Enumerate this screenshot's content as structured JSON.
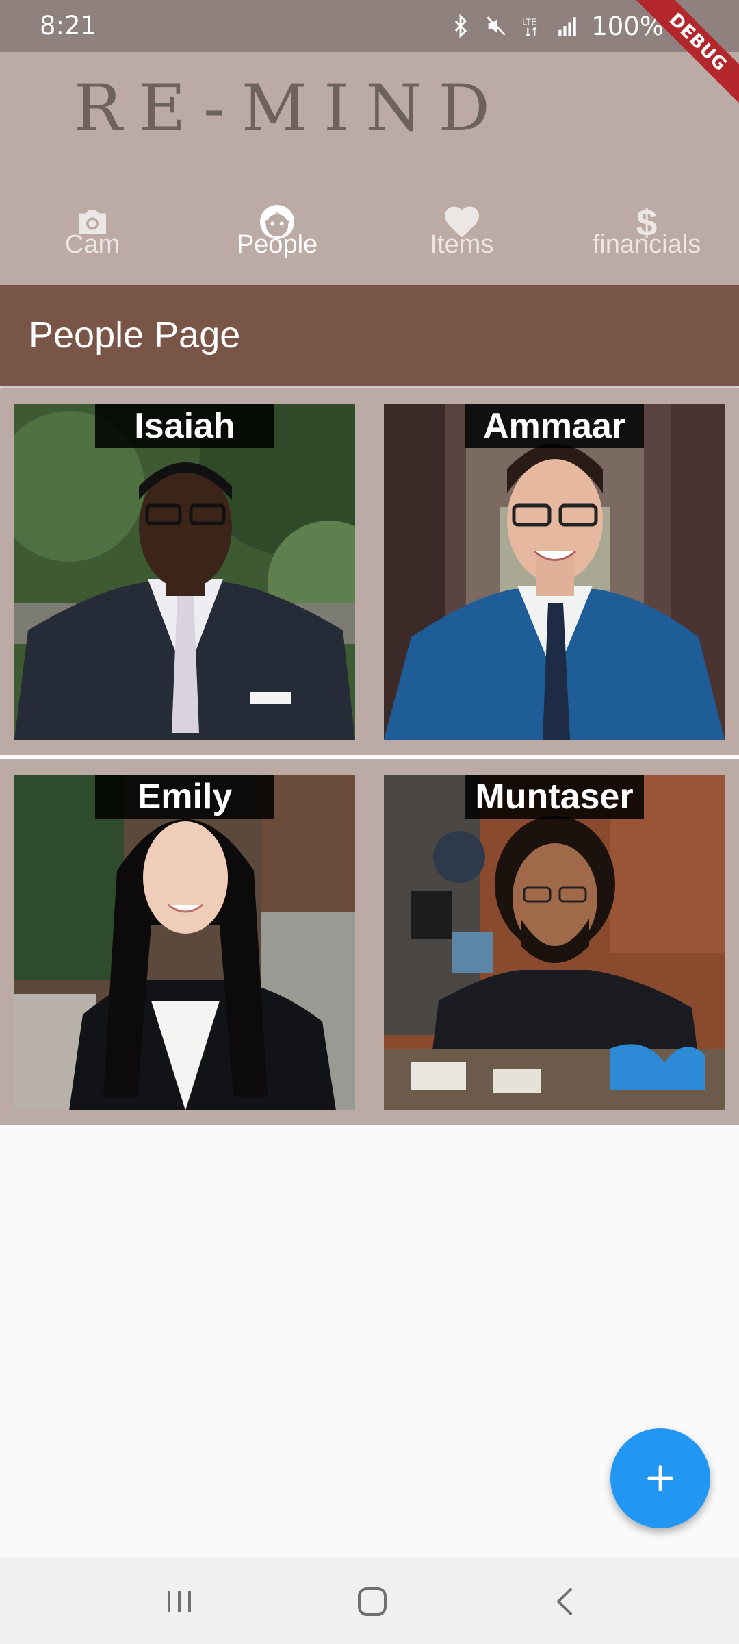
{
  "status_bar": {
    "time": "8:21",
    "battery": "100%",
    "icons": [
      "bluetooth-icon",
      "mute-icon",
      "lte-icon",
      "signal-icon",
      "battery-icon"
    ]
  },
  "debug_banner": "DEBUG",
  "header": {
    "logo": "RE-MIND",
    "tabs": [
      {
        "label": "Cam",
        "icon": "camera-icon",
        "active": false
      },
      {
        "label": "People",
        "icon": "face-icon",
        "active": true
      },
      {
        "label": "Items",
        "icon": "heart-icon",
        "active": false
      },
      {
        "label": "financials",
        "icon": "dollar-icon",
        "active": false
      }
    ]
  },
  "page_title": "People Page",
  "people": [
    {
      "name": "Isaiah"
    },
    {
      "name": "Ammaar"
    },
    {
      "name": "Emily"
    },
    {
      "name": "Muntaser"
    }
  ],
  "fab": {
    "icon": "plus-icon"
  },
  "nav_bar": {
    "icons": [
      "recent-apps-icon",
      "home-icon",
      "back-icon"
    ]
  },
  "colors": {
    "header": "#bcaaa4",
    "app_bar": "#795548",
    "accent": "#2196f3",
    "status_bar": "#8f817d"
  }
}
